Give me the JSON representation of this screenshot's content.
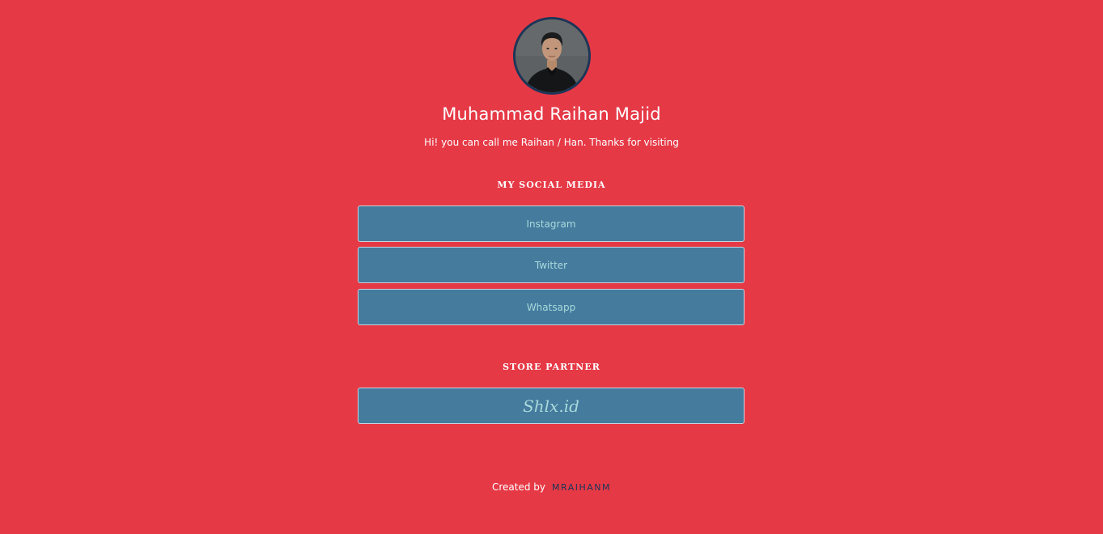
{
  "profile": {
    "name": "Muhammad Raihan Majid",
    "tagline": "Hi! you can call me Raihan / Han. Thanks for visiting",
    "avatar": "profile-photo"
  },
  "social": {
    "title": "MY SOCIAL MEDIA",
    "links": [
      {
        "label": "Instagram"
      },
      {
        "label": "Twitter"
      },
      {
        "label": "Whatsapp"
      }
    ]
  },
  "store": {
    "title": "STORE PARTNER",
    "links": [
      {
        "label": "Shlx.id"
      }
    ]
  },
  "footer": {
    "created_label": "Created by",
    "author": "MRAIHANM"
  },
  "colors": {
    "background": "#e63946",
    "button": "#457b9d",
    "button_text": "#a8dadc",
    "avatar_ring": "#1d3557",
    "author_text": "#1d3557"
  }
}
